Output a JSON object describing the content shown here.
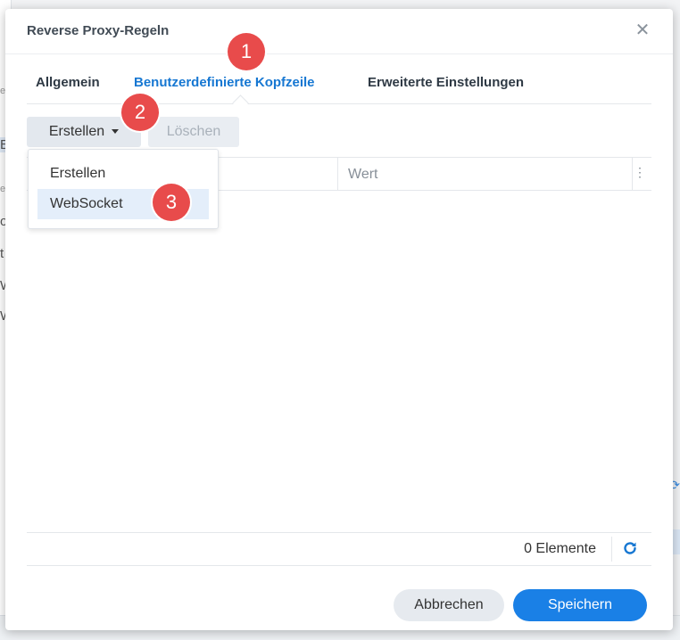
{
  "background": {
    "fragments": [
      "e",
      "E",
      "e",
      "o",
      "t",
      "W",
      "W"
    ]
  },
  "dialog": {
    "title": "Reverse Proxy-Regeln",
    "close_glyph": "✕"
  },
  "tabs": [
    {
      "label": "Allgemein",
      "active": false
    },
    {
      "label": "Benutzerdefinierte Kopfzeile",
      "active": true
    },
    {
      "label": "Erweiterte Einstellungen",
      "active": false
    }
  ],
  "toolbar": {
    "create_label": "Erstellen",
    "delete_label": "Löschen"
  },
  "dropdown": {
    "items": [
      {
        "label": "Erstellen"
      },
      {
        "label": "WebSocket"
      }
    ]
  },
  "grid": {
    "columns": [
      "",
      "Wert"
    ],
    "menu_glyph": "⋮",
    "rows": [],
    "count_label": "0 Elemente"
  },
  "footer": {
    "cancel_label": "Abbrechen",
    "save_label": "Speichern"
  },
  "badges": [
    "1",
    "2",
    "3"
  ],
  "colors": {
    "accent": "#1a80e6",
    "badge": "#e84b4b"
  },
  "icons": {
    "close": "close-icon",
    "refresh": "refresh-icon",
    "dropdown": "chevron-down-icon",
    "column_menu": "more-vertical-icon"
  }
}
